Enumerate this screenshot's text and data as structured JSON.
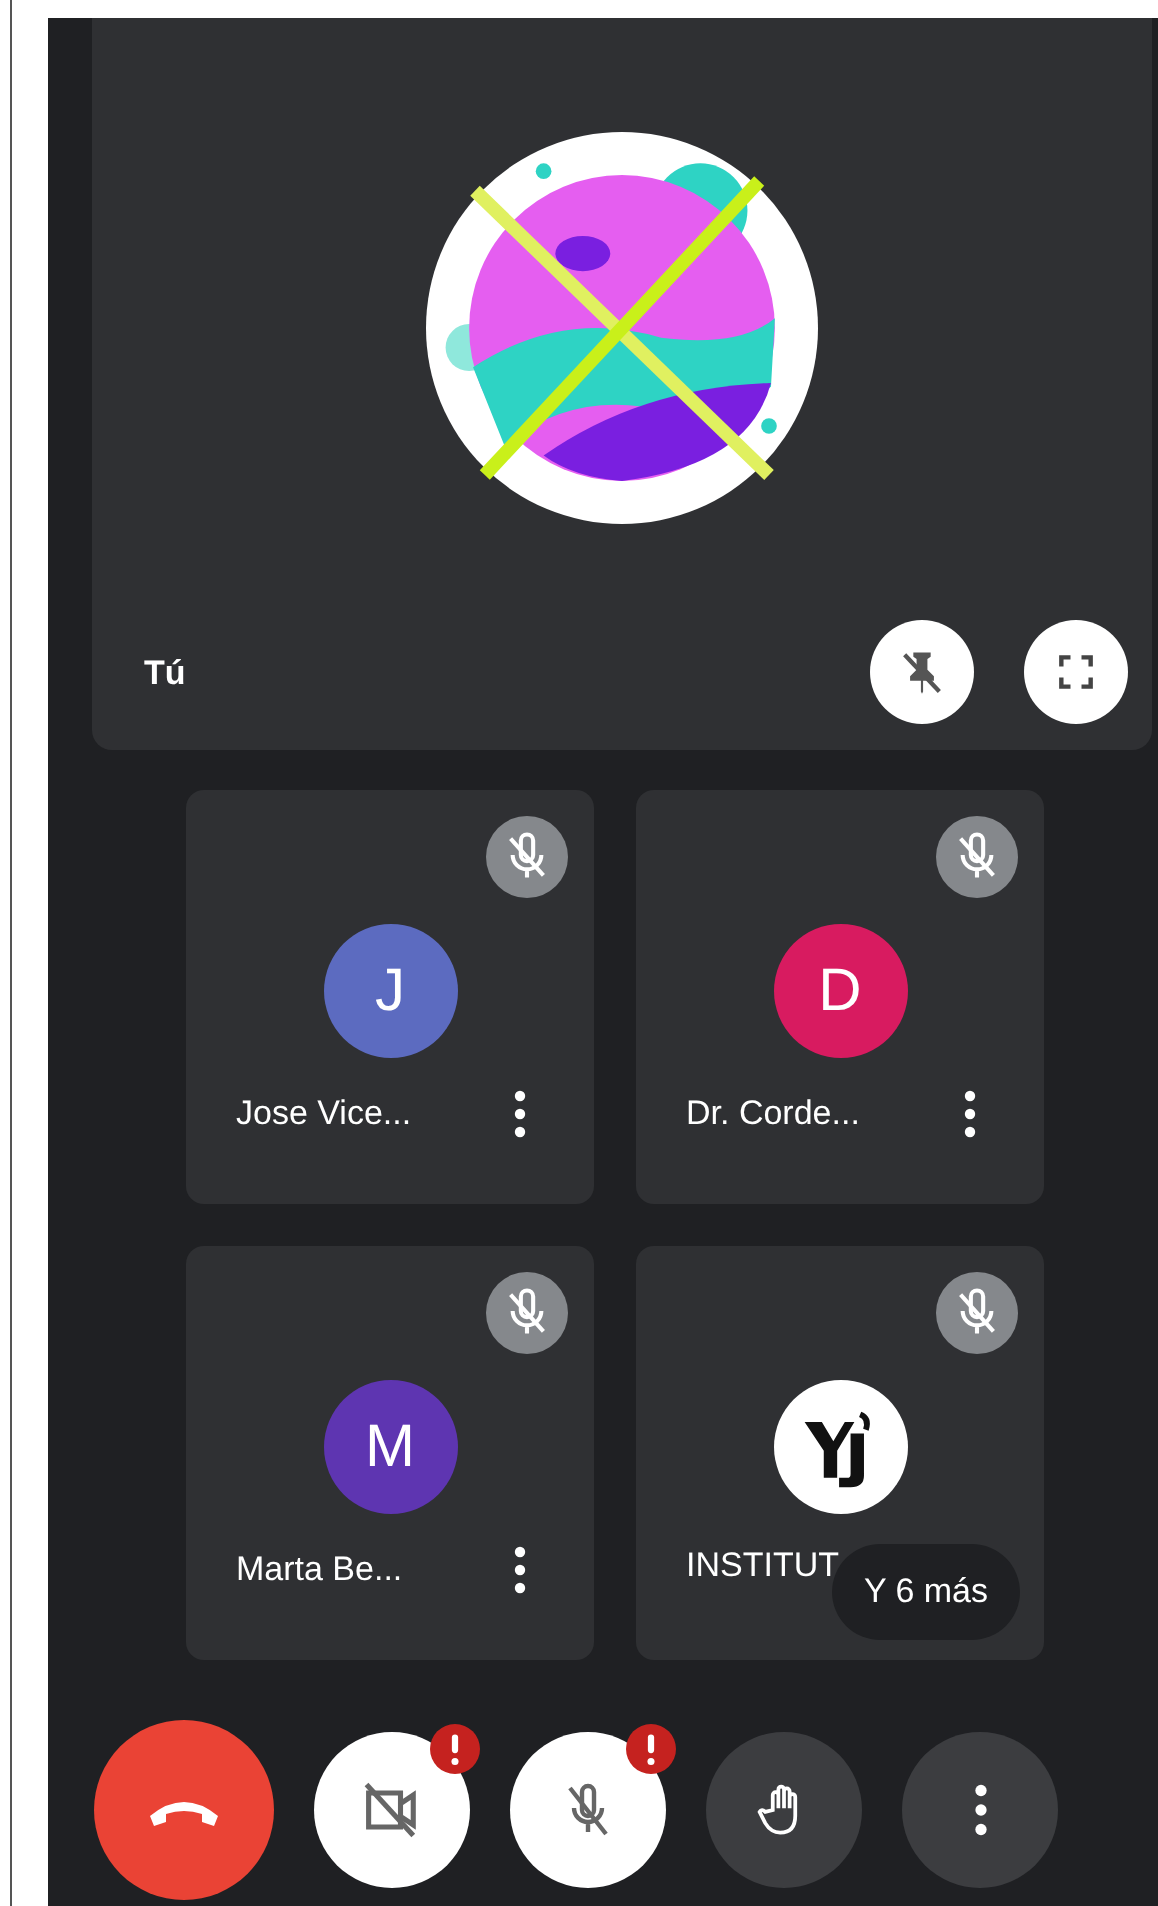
{
  "self_tile": {
    "name": "Tú",
    "pinned": false
  },
  "participants": [
    {
      "name": "Jose Vice...",
      "initial": "J",
      "kind": "letter",
      "color": "#5c6bc0",
      "muted": true
    },
    {
      "name": "Dr. Corde...",
      "initial": "D",
      "kind": "letter",
      "color": "#d81b60",
      "muted": true
    },
    {
      "name": "Marta Be...",
      "initial": "M",
      "kind": "letter",
      "color": "#5e35b1",
      "muted": true
    },
    {
      "name": "INSTITUT",
      "kind": "logo",
      "muted": true
    }
  ],
  "more_chip": "Y 6 más",
  "controls": [
    {
      "kind": "hangup",
      "alert": false
    },
    {
      "kind": "camera",
      "alert": true
    },
    {
      "kind": "mic",
      "alert": true
    },
    {
      "kind": "hand",
      "alert": false
    },
    {
      "kind": "more",
      "alert": false
    }
  ]
}
